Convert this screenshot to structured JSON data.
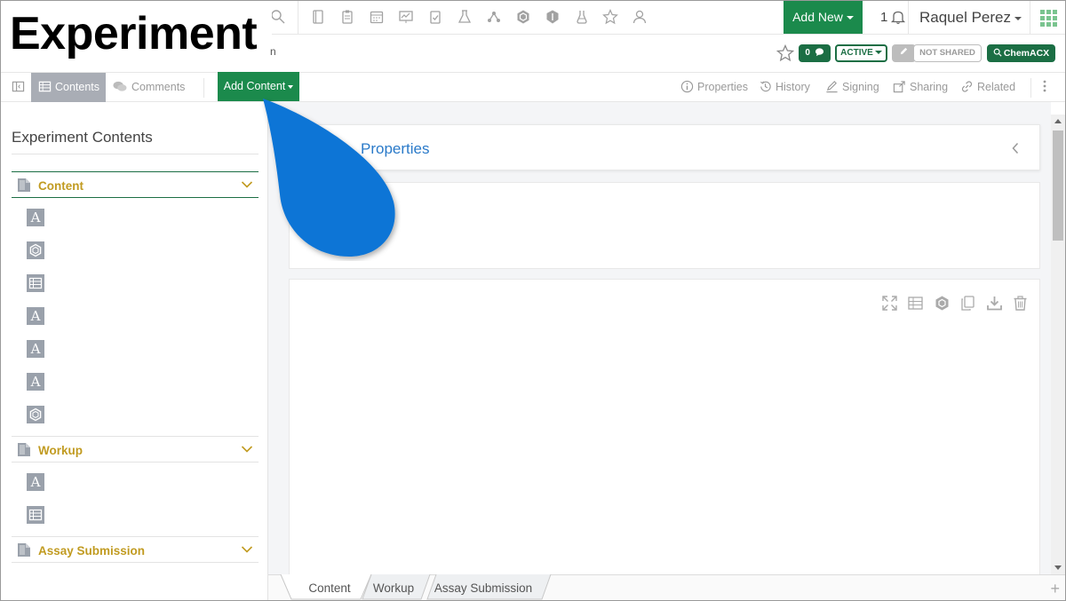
{
  "header": {
    "title": "Experiment",
    "title_tail": "n",
    "add_new_label": "Add New",
    "notification_count": "1",
    "user_name": "Raquel Perez"
  },
  "status": {
    "comment_count": "0",
    "state": "ACTIVE",
    "sharing": "NOT SHARED",
    "chemacx": "ChemACX"
  },
  "toolbar": {
    "contents": "Contents",
    "comments": "Comments",
    "add_content": "Add Content",
    "properties": "Properties",
    "history": "History",
    "signing": "Signing",
    "sharing": "Sharing",
    "related": "Related"
  },
  "left_panel": {
    "title": "Experiment Contents",
    "sections": [
      {
        "label": "Content"
      },
      {
        "label": "Workup"
      },
      {
        "label": "Assay Submission"
      }
    ],
    "item_glyph": "A"
  },
  "main": {
    "properties_title": "Properties"
  },
  "bottom_tabs": [
    "Content",
    "Workup",
    "Assay Submission"
  ],
  "colors": {
    "accent_green": "#1b8a4c",
    "section_gold": "#c19b21",
    "link_blue": "#2a7ac9",
    "drop_blue": "#0a74d6"
  }
}
